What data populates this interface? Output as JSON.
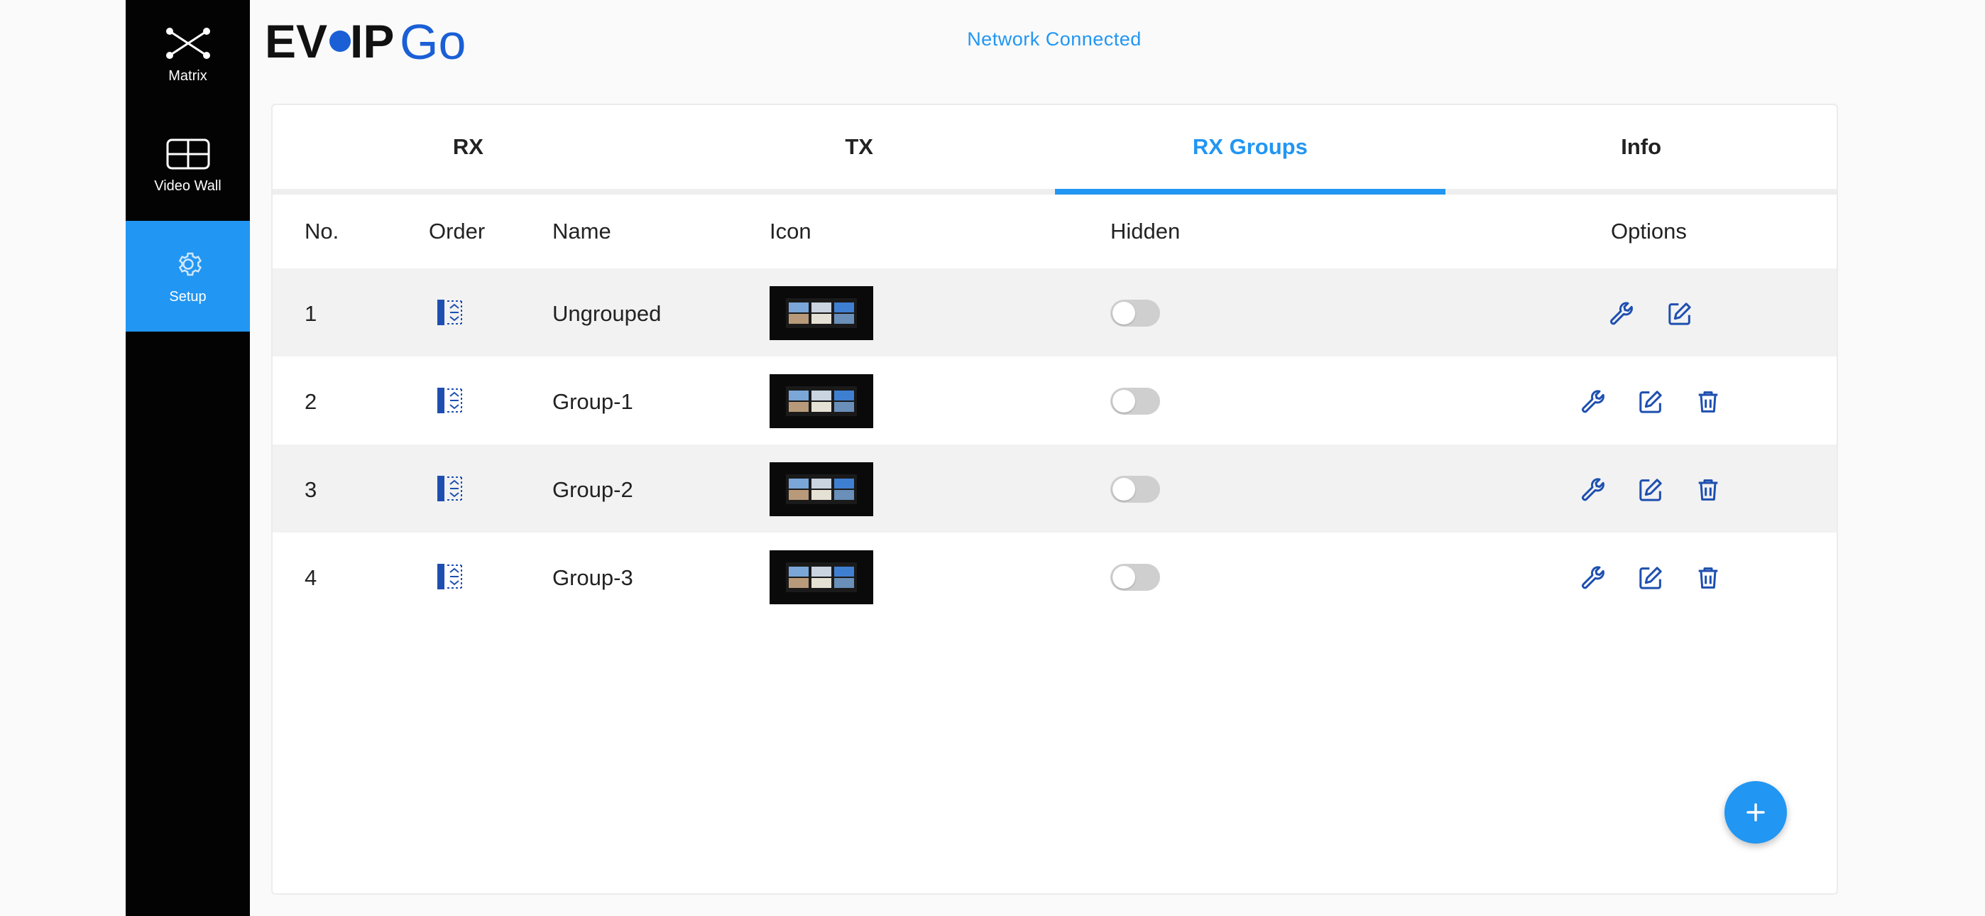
{
  "sidebar": {
    "items": [
      {
        "label": "Matrix",
        "icon": "matrix-icon",
        "active": false
      },
      {
        "label": "Video Wall",
        "icon": "video-wall-icon",
        "active": false
      },
      {
        "label": "Setup",
        "icon": "gear-icon",
        "active": true
      }
    ]
  },
  "header": {
    "logo_text_main": "EV●IP",
    "logo_text_accent": "Go",
    "status": "Network Connected"
  },
  "tabs": [
    {
      "label": "RX",
      "active": false
    },
    {
      "label": "TX",
      "active": false
    },
    {
      "label": "RX Groups",
      "active": true
    },
    {
      "label": "Info",
      "active": false
    }
  ],
  "table": {
    "columns": [
      "No.",
      "Order",
      "Name",
      "Icon",
      "Hidden",
      "Options"
    ],
    "rows": [
      {
        "no": "1",
        "name": "Ungrouped",
        "hidden": false,
        "options": [
          "configure",
          "edit"
        ]
      },
      {
        "no": "2",
        "name": "Group-1",
        "hidden": false,
        "options": [
          "configure",
          "edit",
          "delete"
        ]
      },
      {
        "no": "3",
        "name": "Group-2",
        "hidden": false,
        "options": [
          "configure",
          "edit",
          "delete"
        ]
      },
      {
        "no": "4",
        "name": "Group-3",
        "hidden": false,
        "options": [
          "configure",
          "edit",
          "delete"
        ]
      }
    ]
  },
  "colors": {
    "accent": "#2196f3",
    "sidebar_bg": "#030303",
    "icon_blue": "#1e4fb0",
    "row_shade": "#f2f2f2",
    "toggle_off": "#cfcfcf"
  },
  "fab": {
    "icon": "plus-icon"
  }
}
